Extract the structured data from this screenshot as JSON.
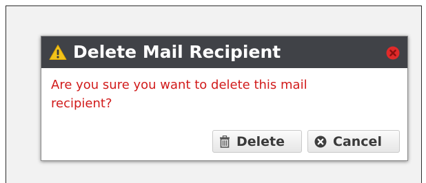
{
  "dialog": {
    "title": "Delete Mail Recipient",
    "title_icon": "warning-icon",
    "close_icon": "close-icon",
    "message": "Are you sure you want to delete this mail recipient?",
    "buttons": {
      "delete_label": "Delete",
      "delete_icon": "trash-icon",
      "cancel_label": "Cancel",
      "cancel_icon": "cancel-icon"
    }
  },
  "colors": {
    "titlebar_bg": "#404247",
    "message_text": "#d11a1a",
    "warning_icon": "#f2c21b",
    "close_icon": "#e02a2a"
  }
}
